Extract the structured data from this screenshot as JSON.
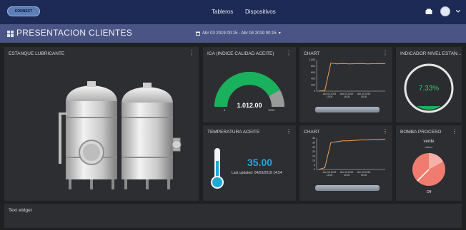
{
  "topbar": {
    "logo_text": "CONNECT",
    "nav": {
      "tableros": "Tableros",
      "dispositivos": "Dispositivos"
    }
  },
  "subbar": {
    "title": "PRESENTACION CLIENTES",
    "date_range": "Abr 03 2019 00:15 - Abr 04 2019 00:15",
    "date_caret": "▾"
  },
  "tank_panel": {
    "title": "ESTANQUE LUBRICANTE",
    "menu": "⋮"
  },
  "ica_panel": {
    "title": "ICA (INDICE CALIDAD ACEITE)",
    "menu": "⋮",
    "value": "1.012.00",
    "min": "0",
    "max": "1200",
    "fill_fraction": 0.84,
    "color": "#19b15b"
  },
  "level_panel": {
    "title": "INDICADOR NIVEL ESTAN...",
    "menu": "⋮",
    "value": "7.33%",
    "fraction": 0.0733,
    "color": "#2fcf6f"
  },
  "temp_panel": {
    "title": "TEMPERATURA ACEITE",
    "menu": "⋮",
    "value": "35.00",
    "updated": "Last updated: 04/03/2019 14:54",
    "color": "#1fa9d6"
  },
  "pump_panel": {
    "title": "BOMBA PROCESO",
    "menu": "⋮",
    "label_on": "verde",
    "label_sub": "ultimo",
    "label_off": "Off",
    "color": "#f07b6f"
  },
  "text_panel": {
    "title": "Text widget"
  },
  "chart_data": [
    {
      "type": "line",
      "title": "Chart",
      "ylim": [
        0,
        1000
      ],
      "yticks": [
        "1,000",
        "800",
        "600",
        "400",
        "200",
        "0"
      ],
      "xticks": [
        "Abr 03 2019\n13:00",
        "Abr 03 2019\n14:00",
        "Abr 03 2019\n15:00"
      ],
      "series": [
        {
          "color": "#f2a05a",
          "values": [
            0,
            15,
            900,
            870,
            880,
            870,
            875,
            880,
            870,
            875,
            880,
            875
          ]
        }
      ]
    },
    {
      "type": "line",
      "title": "Chart",
      "ylim": [
        0,
        35
      ],
      "yticks": [
        "35",
        "30",
        "25",
        "20",
        "15",
        "10",
        "5",
        "0"
      ],
      "xticks": [
        "Abr 03 2019\n13:00",
        "Abr 03 2019\n14:00",
        "Abr 03 2019\n15:00"
      ],
      "series": [
        {
          "color": "#f2a05a",
          "values": [
            0,
            2,
            30,
            31,
            32,
            32,
            32.5,
            33,
            33,
            33.5,
            33.5,
            34
          ]
        }
      ]
    }
  ]
}
